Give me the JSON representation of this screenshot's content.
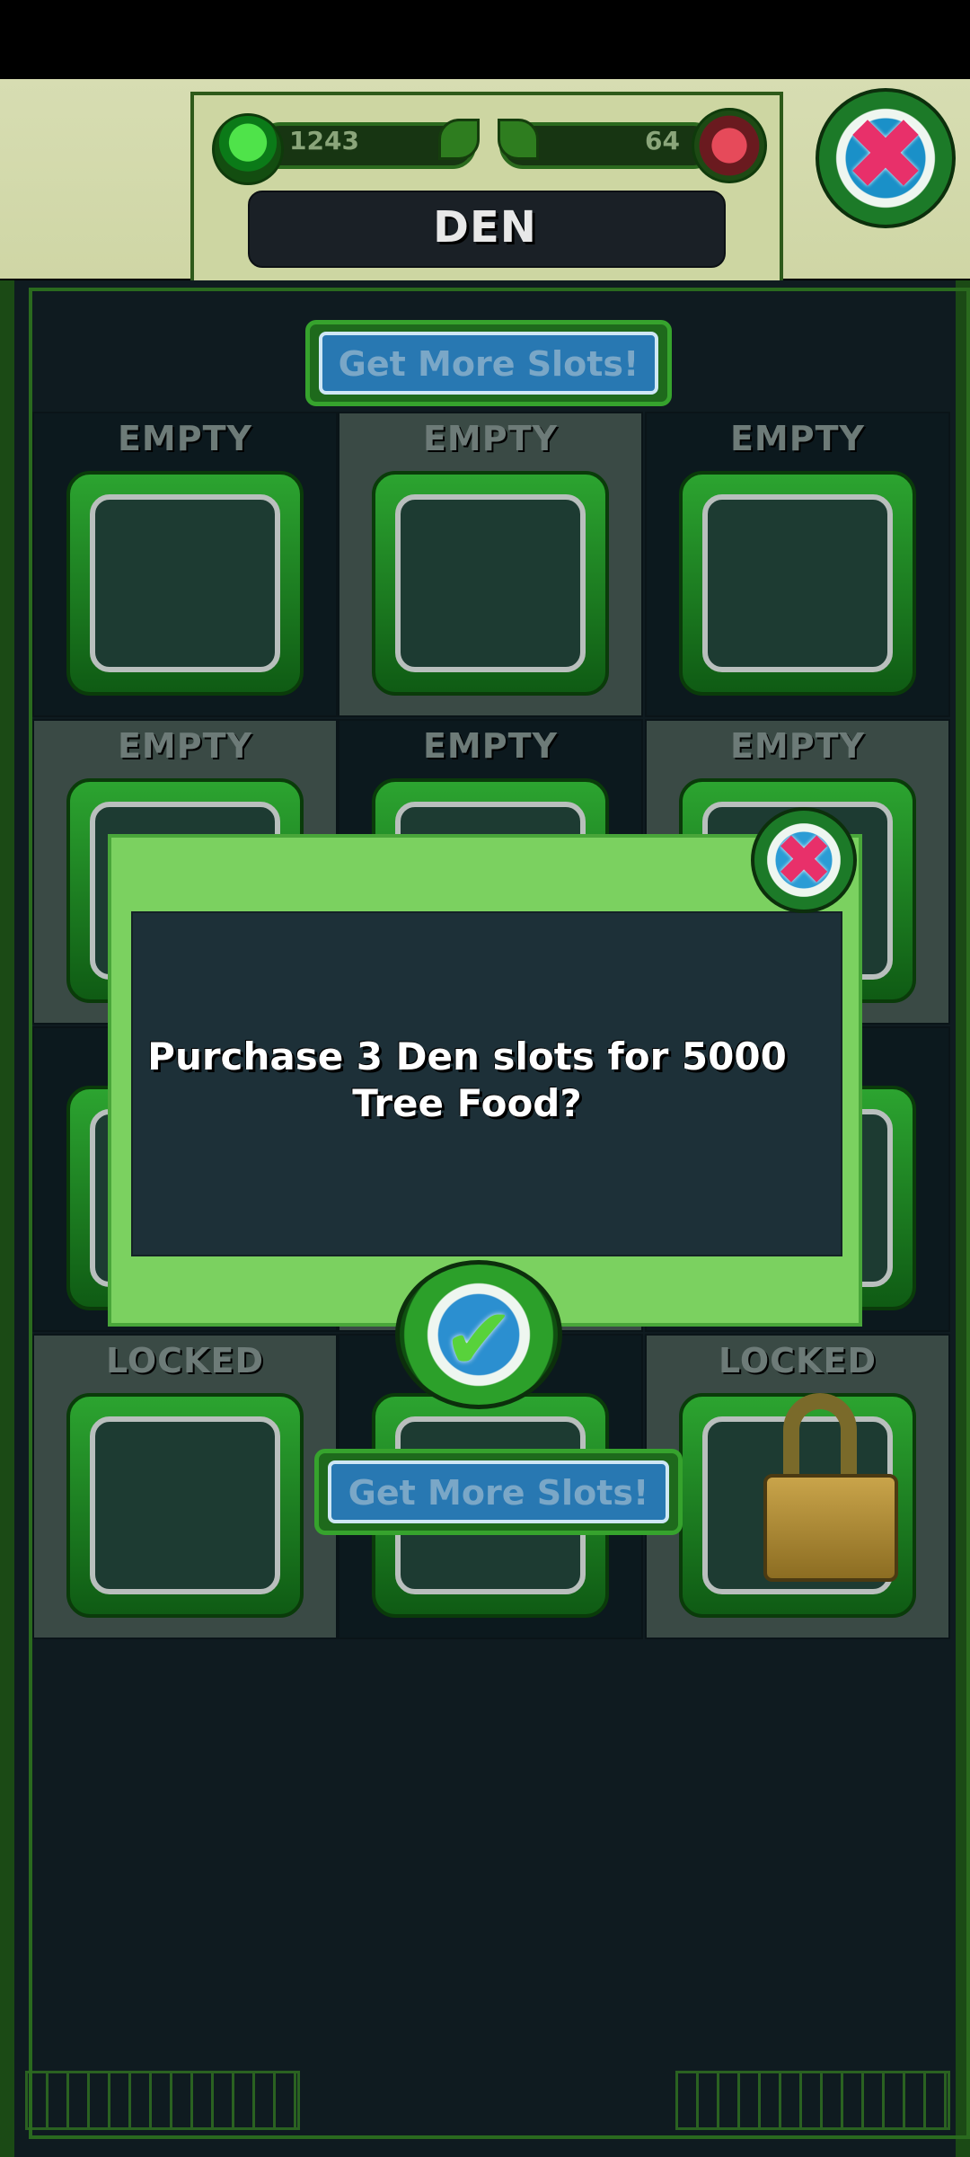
{
  "header": {
    "resource_left": "1243",
    "resource_right": "64",
    "title": "DEN"
  },
  "get_more_slots_label": "Get More Slots!",
  "grid": {
    "cells": [
      {
        "label": "EMPTY",
        "shade": "dark"
      },
      {
        "label": "EMPTY",
        "shade": "light"
      },
      {
        "label": "EMPTY",
        "shade": "dark"
      },
      {
        "label": "EMPTY",
        "shade": "light"
      },
      {
        "label": "EMPTY",
        "shade": "dark"
      },
      {
        "label": "EMPTY",
        "shade": "light"
      },
      {
        "label": "",
        "shade": "dark"
      },
      {
        "label": "",
        "shade": "light"
      },
      {
        "label": "",
        "shade": "dark"
      },
      {
        "label": "LOCKED",
        "shade": "light"
      },
      {
        "label": "",
        "shade": "dark"
      },
      {
        "label": "LOCKED",
        "shade": "light"
      }
    ]
  },
  "dialog": {
    "message": "Purchase 3 Den slots for 5000 Tree Food?"
  },
  "icons": {
    "close": "close-icon",
    "confirm": "checkmark-icon",
    "lock": "padlock-icon",
    "gumdrop": "tree-food-icon",
    "gem": "gem-icon"
  },
  "colors": {
    "dialog_green": "#7bd160",
    "board_bg": "#0f1b20",
    "header_bg": "#d9dfb3",
    "button_blue": "#2878b2"
  }
}
